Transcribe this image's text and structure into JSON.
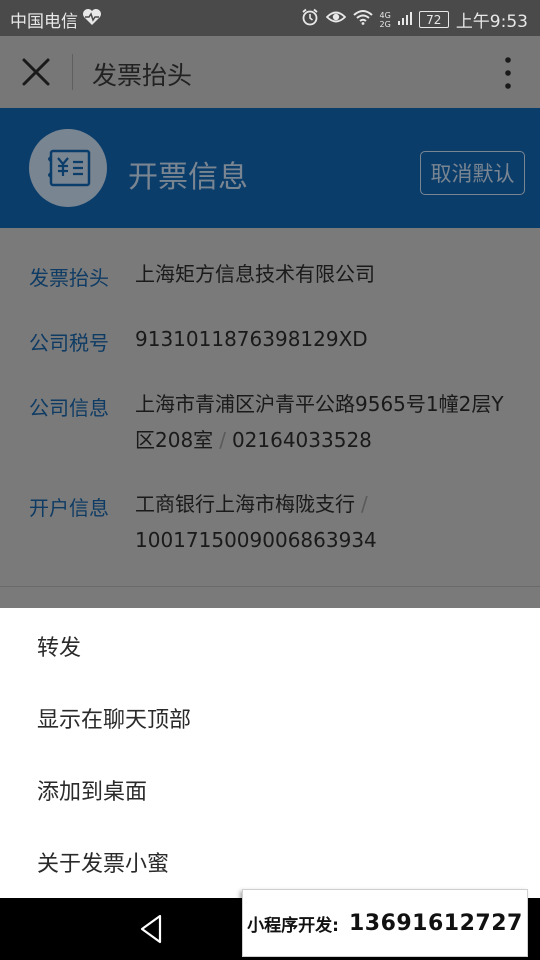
{
  "status_bar": {
    "carrier": "中国电信",
    "battery": "72",
    "signal_top": "4G",
    "signal_bottom": "2G",
    "time": "上午9:53"
  },
  "app_bar": {
    "title": "发票抬头"
  },
  "banner": {
    "title": "开票信息",
    "unset_default_label": "取消默认"
  },
  "fields": {
    "invoice_title": {
      "label": "发票抬头",
      "value": "上海矩方信息技术有限公司"
    },
    "tax_id": {
      "label": "公司税号",
      "value": "9131011876398129XD"
    },
    "company_info": {
      "label": "公司信息",
      "address_line1": "上海市青浦区沪青平公路9565号1幢2层Y",
      "address_line2": "区208室",
      "phone": "02164033528"
    },
    "bank_info": {
      "label": "开户信息",
      "bank": "工商银行上海市梅陇支行",
      "account": "1001715009006863934"
    },
    "separator": "/"
  },
  "sheet": {
    "items": [
      "转发",
      "显示在聊天顶部",
      "添加到桌面",
      "关于发票小蜜"
    ]
  },
  "watermark": {
    "label": "小程序开发:",
    "phone": "13691612727"
  },
  "colors": {
    "status_bar": "#4a4a4a",
    "app_bar": "#777777",
    "banner": "#0b3d6a",
    "content_bg": "#7a7a7a",
    "label_blue": "#0e3b64",
    "sheet_bg": "#ffffff",
    "nav_bar": "#000000"
  },
  "icons": [
    "heart-monitor-icon",
    "alarm-icon",
    "eye-icon",
    "wifi-icon",
    "close-icon",
    "more-vertical-icon",
    "invoice-yen-icon",
    "back-triangle-icon"
  ]
}
